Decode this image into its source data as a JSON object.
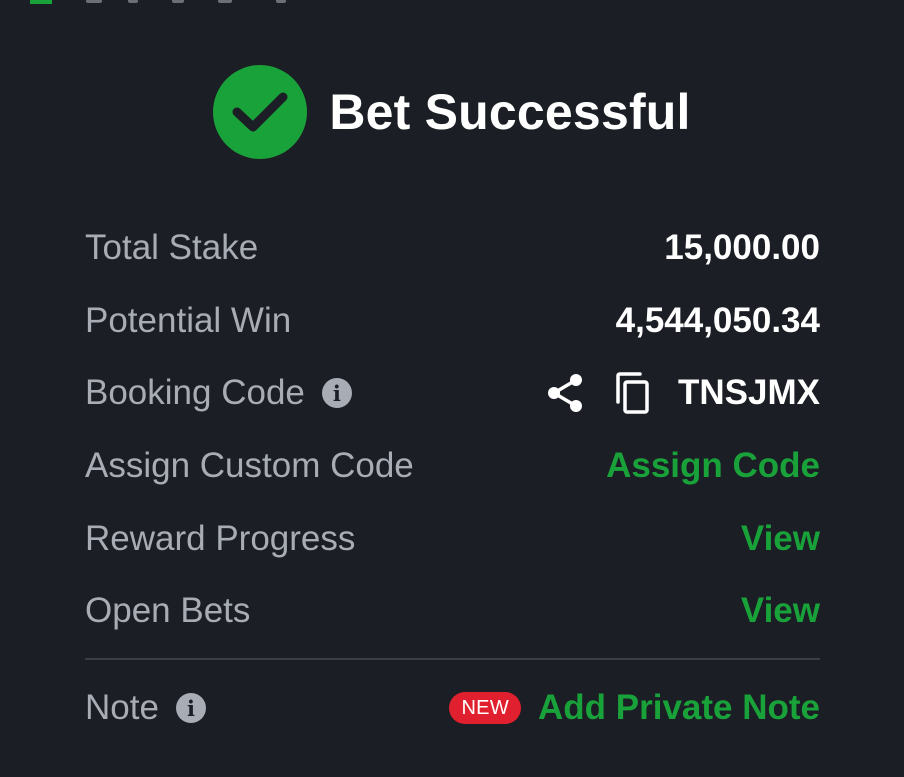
{
  "header": {
    "icon": "check-circle-icon",
    "title": "Bet Successful"
  },
  "rows": [
    {
      "label": "Total Stake",
      "value": "15,000.00"
    },
    {
      "label": "Potential Win",
      "value": "4,544,050.34"
    },
    {
      "label": "Booking Code",
      "value": "TNSJMX",
      "info_icon": "info-icon",
      "actions": [
        "share-icon",
        "copy-icon"
      ]
    },
    {
      "label": "Assign Custom Code",
      "link": "Assign Code"
    },
    {
      "label": "Reward Progress",
      "link": "View"
    },
    {
      "label": "Open Bets",
      "link": "View"
    }
  ],
  "note": {
    "label": "Note",
    "info_icon": "info-icon",
    "badge": "NEW",
    "link": "Add Private Note"
  },
  "colors": {
    "background": "#1b1e24",
    "accent_green": "#1aa23a",
    "label_gray": "#a8acb4",
    "value_white": "#ffffff",
    "badge_red": "#e0202e",
    "divider": "#3a3e46"
  }
}
